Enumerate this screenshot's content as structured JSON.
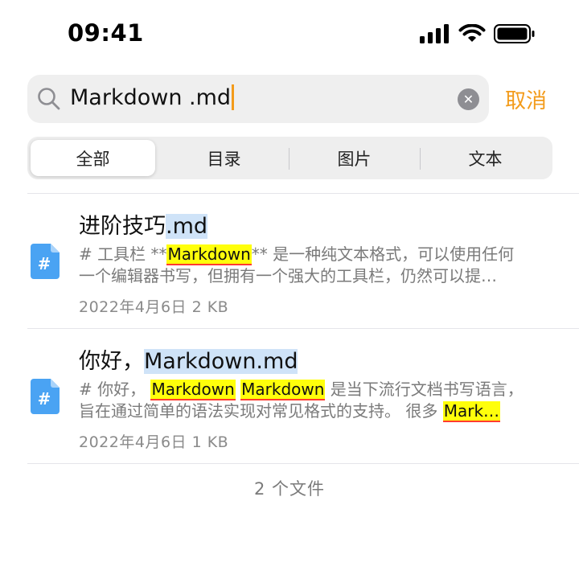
{
  "status_bar": {
    "time": "09:41"
  },
  "search": {
    "query": "Markdown .md",
    "cancel_label": "取消",
    "clear_glyph": "✕"
  },
  "tabs": [
    {
      "label": "全部",
      "active": true
    },
    {
      "label": "目录",
      "active": false
    },
    {
      "label": "图片",
      "active": false
    },
    {
      "label": "文本",
      "active": false
    }
  ],
  "results": [
    {
      "icon": "markdown-file-icon",
      "icon_glyph": "#",
      "title_plain": "进阶技巧",
      "title_highlight": ".md",
      "snippet_line1_a": "# 工具栏 **",
      "snippet_line1_hl": "Markdown",
      "snippet_line1_b": "** 是一种纯文本格式，可以使用任何",
      "snippet_line2": "一个编辑器书写，但拥有一个强大的工具栏，仍然可以提…",
      "date": "2022年4月6日",
      "size": "2 KB"
    },
    {
      "icon": "markdown-file-icon",
      "icon_glyph": "#",
      "title_plain": "你好，",
      "title_highlight": "Markdown.md",
      "snippet_line1_a": "# 你好，",
      "snippet_line1_hl1": "Markdown",
      "snippet_line1_hl2": "Markdown",
      "snippet_line1_b": " 是当下流行文档书写语言，",
      "snippet_line2_a": "旨在通过简单的语法实现对常见格式的支持。 很多 ",
      "snippet_line2_hl": "Mark…",
      "date": "2022年4月6日",
      "size": "1 KB"
    }
  ],
  "footer": {
    "count_label": "2 个文件"
  },
  "colors": {
    "accent": "#f39b1a",
    "match_highlight": "#ffff0b",
    "title_highlight": "#cfe3f8",
    "file_icon": "#4aa3f3"
  }
}
